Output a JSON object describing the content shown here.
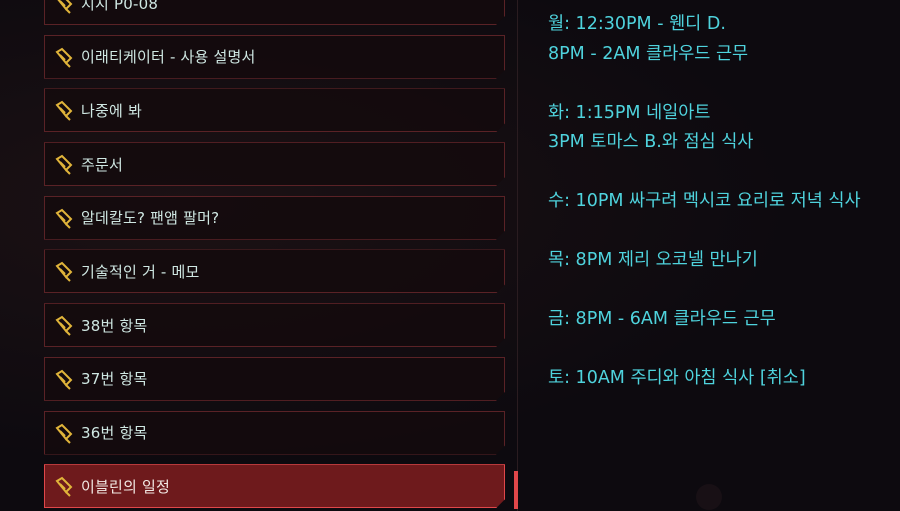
{
  "colors": {
    "accent": "#e0474a",
    "item_border": "#5a2226",
    "selected_fill": "#6e1a1c",
    "schedule_text": "#4fd3dd",
    "label_text": "#cfe7e2",
    "icon_gold": "#e0b43a"
  },
  "shard_list": {
    "icon": "data-shard-icon",
    "items": [
      {
        "label": "지시 P0-08"
      },
      {
        "label": "이래티케이터 - 사용 설명서"
      },
      {
        "label": "나중에 봐"
      },
      {
        "label": "주문서"
      },
      {
        "label": "알데칼도? 팬앰 팔머?"
      },
      {
        "label": "기술적인 거 - 메모"
      },
      {
        "label": "38번 항목"
      },
      {
        "label": "37번 항목"
      },
      {
        "label": "36번 항목"
      },
      {
        "label": "이블린의 일정"
      }
    ],
    "selected_index": 9
  },
  "schedule": {
    "lines": [
      "월: 12:30PM - 웬디 D.",
      "8PM - 2AM 클라우드 근무",
      "",
      "화: 1:15PM 네일아트",
      "3PM 토마스 B.와 점심 식사",
      "",
      "수: 10PM 싸구려 멕시코 요리로 저녁 식사",
      "",
      "목: 8PM 제리 오코넬 만나기",
      "",
      "금: 8PM - 6AM 클라우드 근무",
      "",
      "토: 10AM 주디와 아침 식사 [취소]"
    ]
  }
}
